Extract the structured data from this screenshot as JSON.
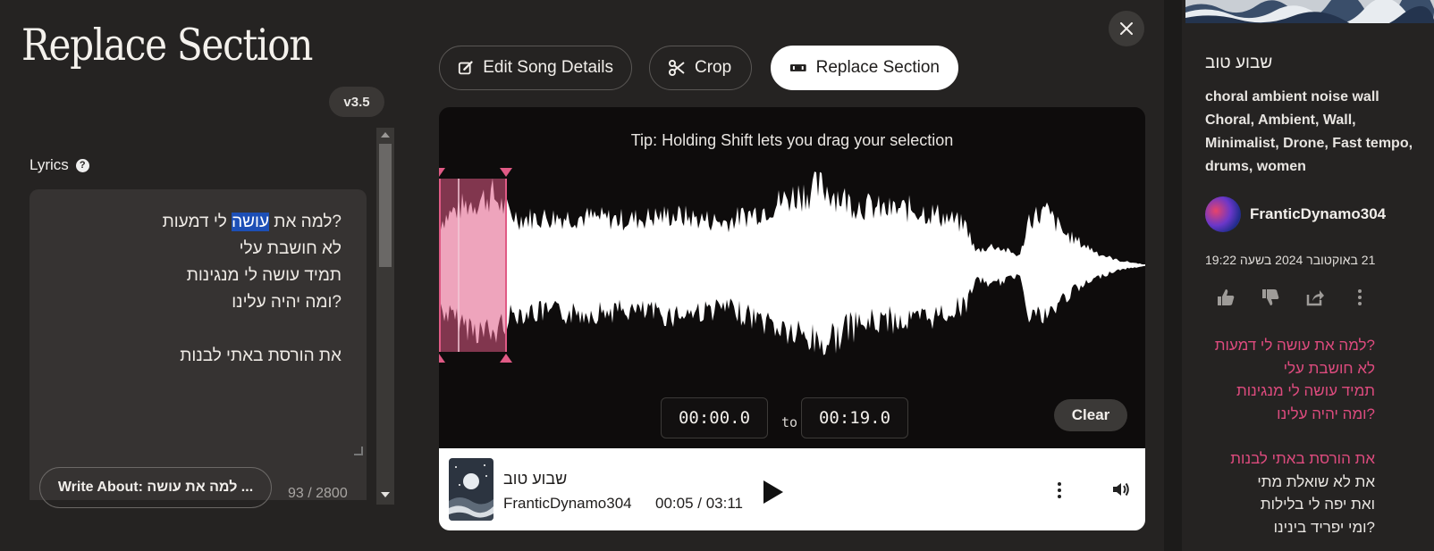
{
  "left": {
    "title": "Replace Section",
    "version": "v3.5",
    "lyrics_label": "Lyrics",
    "help_glyph": "?",
    "lyrics_line1_pre": "?למה את ",
    "lyrics_line1_hl": "עושה",
    "lyrics_line1_post": " לי דמעות",
    "lyrics_lines": [
      "לא חושבת עלי",
      "תמיד עושה לי מנגינות",
      "?ומה יהיה עלינו",
      "",
      "את הורסת באתי לבנות"
    ],
    "write_about": "Write About: למה את עושה ...",
    "char_count": "93 / 2800"
  },
  "tabs": {
    "edit": "Edit Song Details",
    "crop": "Crop",
    "replace": "Replace Section"
  },
  "waveform": {
    "tip": "Tip: Holding Shift lets you drag your selection",
    "start_time": "00:00.0",
    "to": "to",
    "end_time": "00:19.0",
    "clear": "Clear",
    "selection": {
      "start_s": 0.0,
      "end_s": 19.0
    }
  },
  "player": {
    "title": "שבוע טוב",
    "artist": "FranticDynamo304",
    "time": "00:05 / 03:11",
    "progress": 0.026
  },
  "right": {
    "title": "שבוע טוב",
    "style": "choral ambient noise wall",
    "tags_line1": "Choral, Ambient, Wall,",
    "tags_line2": "Minimalist, Drone, Fast tempo,",
    "tags_line3": "drums, women",
    "user": "FranticDynamo304",
    "date": "21 באוקטובר 2024 בשעה 19:22",
    "lyrics_pink": [
      "?למה את עושה לי דמעות",
      "לא חושבת עלי",
      "תמיד עושה לי מנגינות",
      "?ומה יהיה עלינו"
    ],
    "lyrics_pink2": "את הורסת באתי לבנות",
    "lyrics_white": [
      "את לא שואלת מתי",
      "ואת יפה לי בלילות",
      "?ומי יפריד בינינו"
    ]
  },
  "colors": {
    "accent_pink": "#dd4b7e",
    "selection": "#e05a85",
    "highlight": "#1d4fb6"
  },
  "icons": [
    "close-icon",
    "edit-icon",
    "scissors-icon",
    "replace-icon",
    "play-icon",
    "more-icon",
    "volume-icon",
    "like-icon",
    "dislike-icon",
    "share-icon",
    "help-icon"
  ]
}
